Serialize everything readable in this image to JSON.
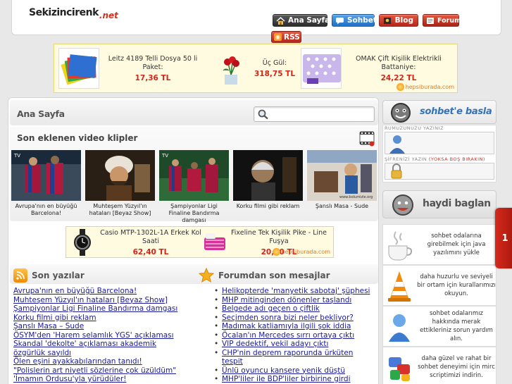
{
  "header": {
    "logo_main": "Sekizincirenk",
    "logo_ext": ".net",
    "nav": [
      {
        "label": "Ana Sayfa"
      },
      {
        "label": "Sohbet"
      },
      {
        "label": "Blog"
      },
      {
        "label": "Forum"
      }
    ],
    "rss_label": "RSS"
  },
  "top_ads": [
    {
      "name": "Leitz 4189 Telli Dosya 50 li Paket:",
      "price": "17,36 TL"
    },
    {
      "name": "Üç Gül:",
      "price": "318,75 TL"
    },
    {
      "name": "OMAK Çift Kişilik Elektrikli Battaniye:",
      "price": "24,22 TL"
    }
  ],
  "ad_brand": "hepsiburada.com",
  "main": {
    "page_title": "Ana Sayfa",
    "search_placeholder": "",
    "videos_title": "Son eklenen video klipler",
    "videos": [
      {
        "caption": "Avrupa'nın en büyüğü Barcelona!"
      },
      {
        "caption": "Muhteşem Yüzyıl'ın hataları [Beyaz Show]"
      },
      {
        "caption": "Şampiyonlar Ligi Finaline Bandırma damgası"
      },
      {
        "caption": "Korku filmi gibi reklam"
      },
      {
        "caption": "Şanslı Masa - Sude"
      }
    ],
    "mid_ads": [
      {
        "name": "Casio MTP-1302L-1A Erkek Kol Saati",
        "price": "62,40 TL"
      },
      {
        "name": "Fixeline Tek Kişilik Pike - Line Fuşya",
        "price": "20,00 TL"
      }
    ],
    "posts_title": "Son yazılar",
    "posts": [
      "Avrupa'nın en büyüğü Barcelona!",
      "Muhteşem Yüzyıl'ın hataları [Beyaz Show]",
      "Şampiyonlar Ligi Finaline Bandırma damgası",
      "Korku filmi gibi reklam",
      "Şanslı Masa – Sude",
      "ÖSYM'den 'Harem selamlık YGS' açıklaması",
      "Skandal 'dekolte' açıklaması akademik özgürlük sayıldı",
      "Ölen eşini ayakkabılarından tanıdı!",
      "\"Polislerin art niyetli sözlerine çok üzüldüm\"",
      "'İmamın Ordusu'yla yürüdüler!"
    ],
    "forum_title": "Forumdan son mesajlar",
    "forum": [
      "Helikopterde 'manyetik sabotaj' şüphesi",
      "MHP mitinginden dönenler taşlandı",
      "Belgede adı geçen o çiftlik",
      "Seçimden sonra bizi neler bekliyor?",
      "Madımak katliamıyla ilgili şok iddia",
      "Öcalan'ın Mercedes sırrı ortaya çıktı",
      "VIP dedektif, vekil adayı çıktı",
      "CHP'nin deprem raporunda ürküten tespit",
      "Ünlü oyuncu kansere yenik düştü",
      "MHP'liler ile BDP'liler birbirine girdi"
    ]
  },
  "sidebar": {
    "chat_title": "sohbet'e basla",
    "nick_label": "RUMUZUNUZU YAZINIZ",
    "pass_label": "ŞİFRENİZİ YAZIN",
    "pass_warn": "(YOKSA BOŞ BIRAKIN)",
    "connect_label": "haydi baglan",
    "info": [
      {
        "text": "sohbet odalarına girebilmek için java yazılımını yükle"
      },
      {
        "text": "daha huzurlu ve seviyeli bir ortam için kurallarımızı okuyun."
      },
      {
        "text": "sohbet odalarımız hakkında merak ettikleriniz sorun yardım alın."
      },
      {
        "text": "daha güzel ve rahat bir sohbet deneyimi için mirc scriptimizi indirin."
      }
    ],
    "side_tab": "1"
  },
  "colors": {
    "accent_red": "#d4241b",
    "link_blue": "#1a1a9a",
    "chat_blue": "#3473b8"
  }
}
